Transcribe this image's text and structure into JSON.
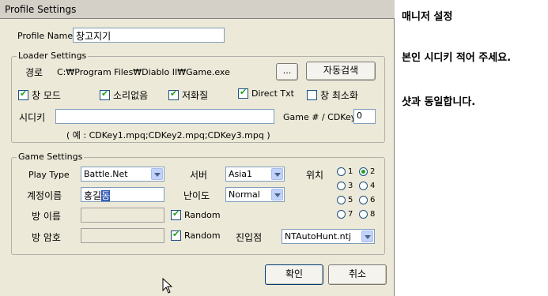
{
  "window": {
    "title": "Profile Settings"
  },
  "profile": {
    "label": "Profile Name",
    "value": "창고지기"
  },
  "loader": {
    "title": "Loader Settings",
    "path_label": "경로",
    "path_value": "C:₩Program Files₩Diablo II₩Game.exe",
    "browse_label": "...",
    "autosearch_label": "자동검색",
    "checks": {
      "window_mode": "창 모드",
      "no_sound": "소리없음",
      "low_quality": "저화질",
      "direct_txt": "Direct Txt",
      "minimize": "창 최소화"
    },
    "cdkey_label": "시디키",
    "cdkey_value": "",
    "game_cdkey_label": "Game # / CDKey",
    "game_cdkey_value": "0",
    "example": "( 예 : CDKey1.mpq;CDKey2.mpq;CDKey3.mpq )"
  },
  "game": {
    "title": "Game Settings",
    "play_type_label": "Play Type",
    "play_type_value": "Battle.Net",
    "server_label": "서버",
    "server_value": "Asia1",
    "position_label": "위치",
    "radios": [
      "1",
      "2",
      "3",
      "4",
      "5",
      "6",
      "7",
      "8"
    ],
    "account_label": "계정이름",
    "account_value": "홍길",
    "account_sel": "동",
    "difficulty_label": "난이도",
    "difficulty_value": "Normal",
    "room_name_label": "방 이름",
    "room_pw_label": "방 암호",
    "random_label": "Random",
    "random2_label": "Random",
    "entry_label": "진입점",
    "entry_value": "NTAutoHunt.ntj"
  },
  "buttons": {
    "ok": "확인",
    "cancel": "취소"
  },
  "notes": {
    "line1": "매니저 설정",
    "line2": "본인 시디키 적어 주세요.",
    "line3": "샷과 동일합니다."
  }
}
